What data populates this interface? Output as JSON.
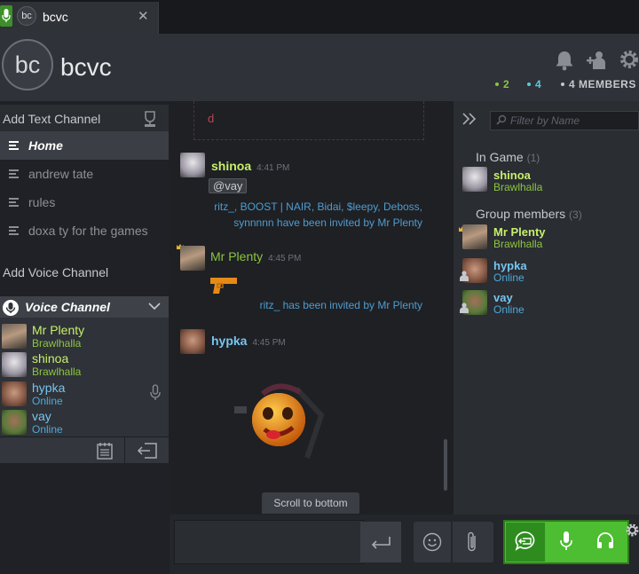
{
  "tab": {
    "avatar_initials": "bc",
    "name": "bcvc",
    "close_glyph": "✕"
  },
  "header": {
    "avatar_initials": "bc",
    "name": "bcvc",
    "ingame_count": "2",
    "online_count": "4",
    "members_label": "4 MEMBERS",
    "icons": [
      "bell-icon",
      "add-friend-icon",
      "settings-icon"
    ]
  },
  "sidebar": {
    "add_text_channel": "Add Text Channel",
    "channels": [
      {
        "label": "Home",
        "active": true
      },
      {
        "label": "andrew tate"
      },
      {
        "label": "rules"
      },
      {
        "label": "doxa ty for the games"
      }
    ],
    "add_voice_channel": "Add Voice Channel",
    "voice": {
      "title": "Voice Channel",
      "members": [
        {
          "name": "Mr Plenty",
          "status": "Brawlhalla"
        },
        {
          "name": "shinoa",
          "status": "Brawlhalla"
        },
        {
          "name": "hypka",
          "status": "Online"
        },
        {
          "name": "vay",
          "status": "Online"
        }
      ]
    }
  },
  "chat": {
    "prev_embed_text": "d",
    "messages": [
      {
        "author": "shinoa",
        "time": "4:41 PM",
        "mention": "@vay",
        "system": "ritz_, BOOST | NAIR, Bidai, $leepy, Deboss, synnnnn have been invited by Mr Plenty"
      },
      {
        "author": "Mr Plenty",
        "time": "4:45 PM",
        "system": "ritz_ has been invited by Mr Plenty"
      },
      {
        "author": "hypka",
        "time": "4:45 PM"
      }
    ],
    "scroll_to_bottom": "Scroll to bottom"
  },
  "members_panel": {
    "filter_placeholder": "Filter by Name",
    "in_game_label": "In Game",
    "in_game_count": "(1)",
    "group_label": "Group members",
    "group_count": "(3)",
    "in_game": [
      {
        "name": "shinoa",
        "status": "Brawlhalla"
      }
    ],
    "group": [
      {
        "name": "Mr Plenty",
        "status": "Brawlhalla"
      },
      {
        "name": "hypka",
        "status": "Online"
      },
      {
        "name": "vay",
        "status": "Online"
      }
    ]
  },
  "colors": {
    "in_game": "#8bc53f",
    "online": "#57cbde",
    "voice_active": "#4dbd31"
  }
}
